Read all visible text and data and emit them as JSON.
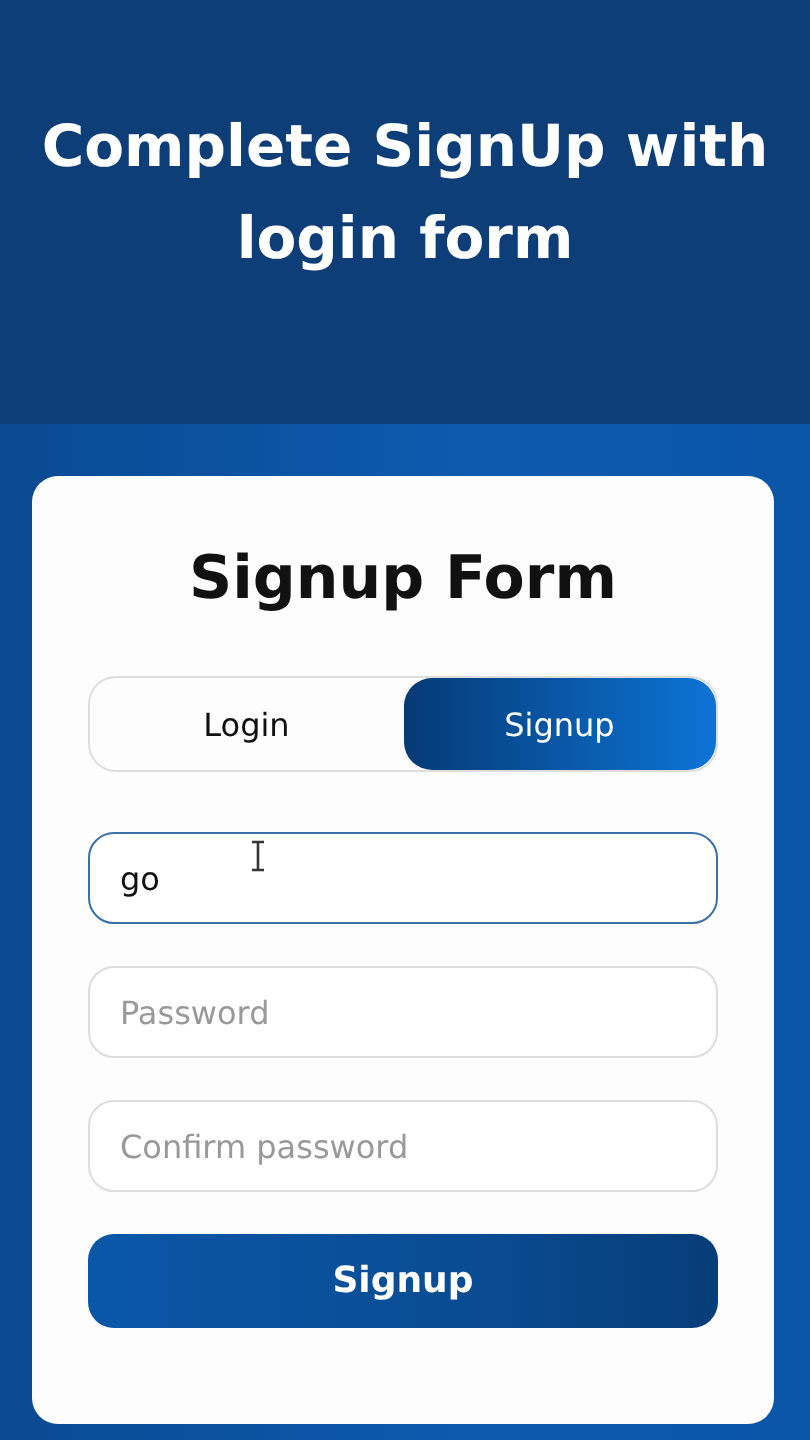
{
  "banner": {
    "title": "Complete SignUp with login form"
  },
  "form": {
    "title": "Signup Form",
    "tabs": [
      {
        "label": "Login",
        "selected": false
      },
      {
        "label": "Signup",
        "selected": true
      }
    ],
    "fields": [
      {
        "value": "go",
        "focused": true
      },
      {
        "placeholder": "Password",
        "focused": false
      },
      {
        "placeholder": "Confirm password",
        "focused": false
      }
    ],
    "submit": "Signup"
  }
}
